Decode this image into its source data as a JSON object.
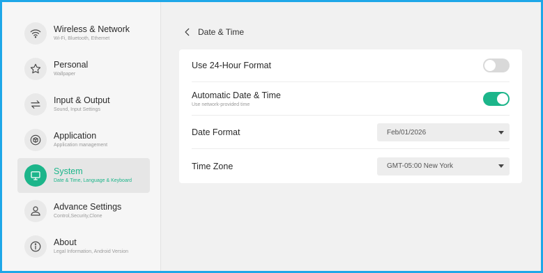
{
  "colors": {
    "accent": "#1cb58a",
    "frame": "#1ea7e8"
  },
  "sidebar": {
    "items": [
      {
        "title": "Wireless & Network",
        "subtitle": "Wi-Fi, Bluetooth, Ethernet",
        "icon": "wifi-icon",
        "active": false
      },
      {
        "title": "Personal",
        "subtitle": "Wallpaper",
        "icon": "star-icon",
        "active": false
      },
      {
        "title": "Input & Output",
        "subtitle": "Sound, Input Settings",
        "icon": "swap-arrows-icon",
        "active": false
      },
      {
        "title": "Application",
        "subtitle": "Application management",
        "icon": "cube-icon",
        "active": false
      },
      {
        "title": "System",
        "subtitle": "Date & Time, Language & Keyboard",
        "icon": "monitor-icon",
        "active": true
      },
      {
        "title": "Advance Settings",
        "subtitle": "Control,Security,Clone",
        "icon": "person-icon",
        "active": false
      },
      {
        "title": "About",
        "subtitle": "Legal Information, Android Version",
        "icon": "info-icon",
        "active": false
      }
    ]
  },
  "header": {
    "title": "Date & Time"
  },
  "settings": {
    "hour24": {
      "label": "Use 24-Hour Format",
      "enabled": false
    },
    "auto_datetime": {
      "label": "Automatic Date & Time",
      "sublabel": "Use network-provided time",
      "enabled": true
    },
    "date_format": {
      "label": "Date Format",
      "value": "Feb/01/2026"
    },
    "time_zone": {
      "label": "Time Zone",
      "value": "GMT-05:00 New York"
    }
  }
}
